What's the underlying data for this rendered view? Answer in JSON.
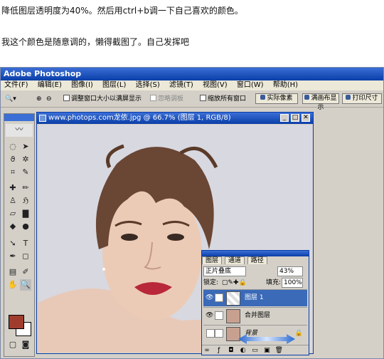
{
  "article": {
    "line1": "降低图层透明度为40%。然后用ctrl+b调一下自己喜欢的颜色。",
    "line2": "我这个颜色是随意调的，懒得截图了。自己发挥吧"
  },
  "app": {
    "title": "Adobe Photoshop",
    "menu": [
      "文件(F)",
      "编辑(E)",
      "图像(I)",
      "图层(L)",
      "选择(S)",
      "滤镜(T)",
      "视图(V)",
      "窗口(W)",
      "帮助(H)"
    ]
  },
  "options_bar": {
    "resize_windows_label": "调整窗口大小以满屏显示",
    "ignore_palettes_label": "忽略调板",
    "zoom_all_label": "缩放所有窗口",
    "actual_pixels": "实际像素",
    "fit_on_screen": "满画布显示",
    "print_size": "打印尺寸"
  },
  "document": {
    "title": "www.photops.com龙依.jpg @ 66.7% (图层 1, RGB/8)"
  },
  "layers_panel": {
    "tabs": [
      "图层",
      "通道",
      "路径"
    ],
    "blend_mode": "正片叠底",
    "opacity": "43%",
    "lock_label": "锁定:",
    "fill_label": "填充:",
    "fill_value": "100%",
    "layers": [
      {
        "name": "图层 1",
        "selected": true
      },
      {
        "name": "合并图层",
        "selected": false
      },
      {
        "name": "背景",
        "selected": false
      }
    ]
  },
  "colors": {
    "foreground": "#a03c2e",
    "background": "#ffffff",
    "title_blue": "#0a3ea8",
    "selected_layer": "#3a6ab8"
  }
}
